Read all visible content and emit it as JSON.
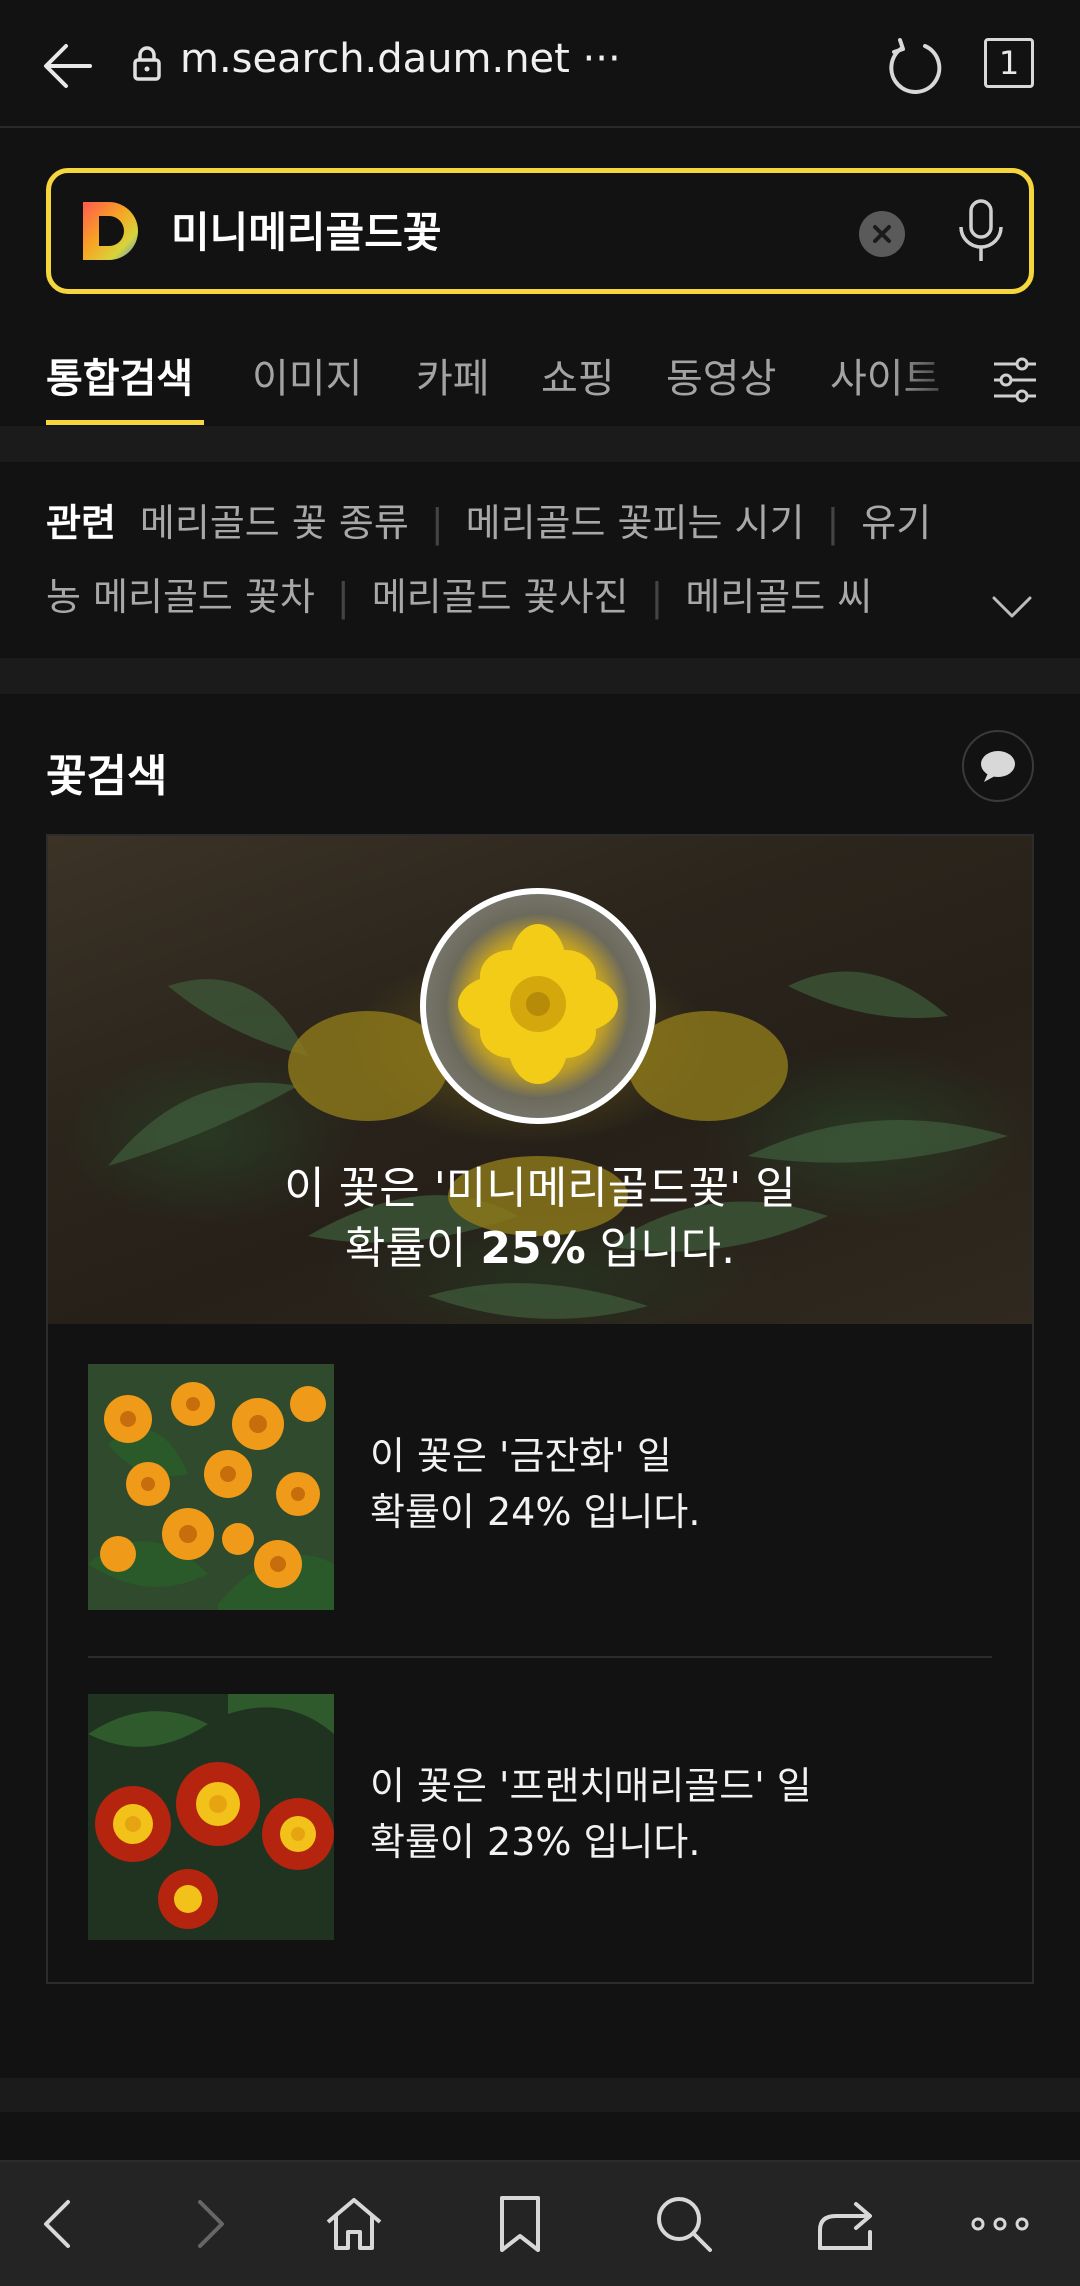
{
  "browser": {
    "url": "m.search.daum.net ···",
    "tab_count": "1"
  },
  "search": {
    "query": "미니메리골드꽃"
  },
  "tabs": [
    {
      "label": "통합검색",
      "active": true
    },
    {
      "label": "이미지"
    },
    {
      "label": "카페"
    },
    {
      "label": "쇼핑"
    },
    {
      "label": "동영상"
    },
    {
      "label": "사이트"
    }
  ],
  "related": {
    "title": "관련",
    "items": [
      "메리골드 꽃 종류",
      "메리골드 꽃피는 시기",
      "유기농 메리골드 꽃차",
      "메리골드 꽃사진",
      "메리골드 씨"
    ],
    "line1_tail": "유기",
    "line2_head": "농 메리골드 꽃차",
    "line2_tail": "메리골드 씨"
  },
  "flower_search": {
    "title": "꽃검색",
    "top_result": {
      "line1": "이 꽃은 '미니메리골드꽃' 일",
      "line2_prefix": "확률이 ",
      "probability": "25%",
      "line2_suffix": " 입니다."
    },
    "results": [
      {
        "line1": "이 꽃은 '금잔화' 일",
        "line2": "확률이 24% 입니다.",
        "probability": 24
      },
      {
        "line1": "이 꽃은 '프랜치매리골드' 일",
        "line2": "확률이 23% 입니다.",
        "probability": 23
      }
    ]
  },
  "colors": {
    "accent": "#f5d63d",
    "background": "#121212"
  },
  "icons": {
    "back": "arrow-left-icon",
    "lock": "lock-icon",
    "reload": "reload-icon",
    "clear": "clear-x-icon",
    "mic": "microphone-icon",
    "filter": "filter-sliders-icon",
    "expand": "chevron-down-icon",
    "feedback": "speech-bubble-icon",
    "nav": [
      "back-chevron-icon",
      "forward-chevron-icon",
      "home-icon",
      "bookmark-icon",
      "search-icon",
      "share-icon",
      "more-dots-icon"
    ]
  }
}
